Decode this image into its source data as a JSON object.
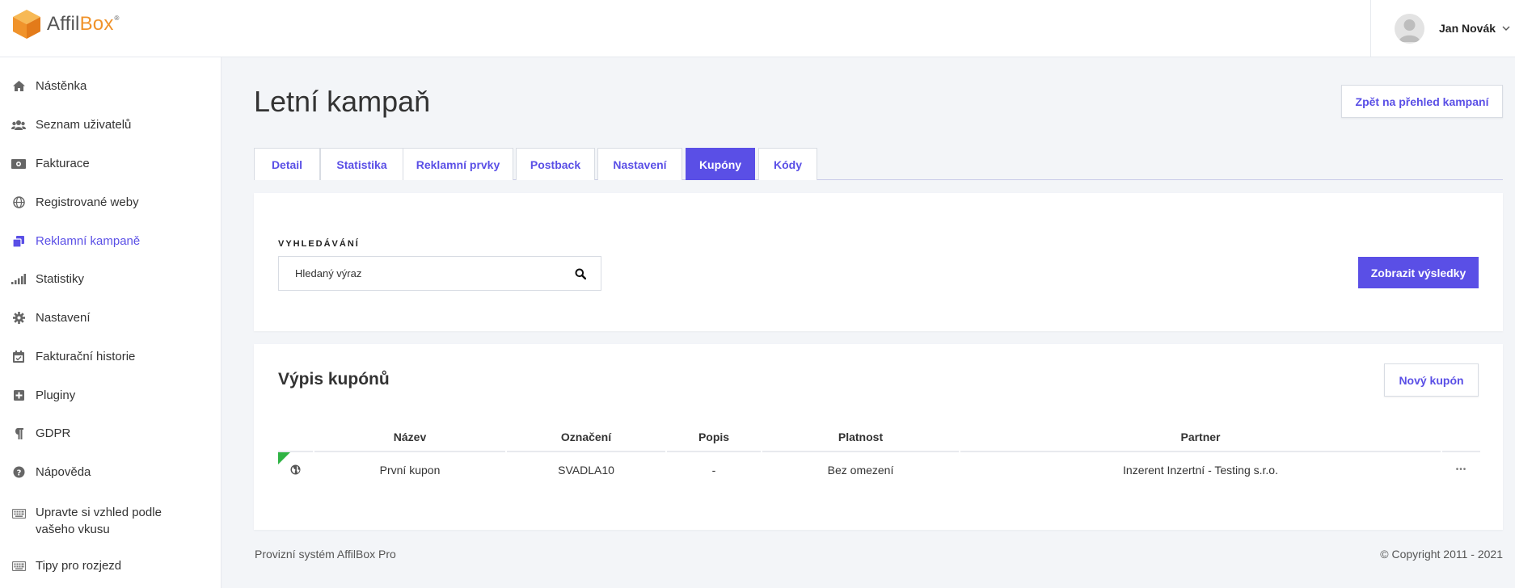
{
  "brand": {
    "part1": "Affil",
    "part2": "Box",
    "reg": "®",
    "accent_color": "#f0932b"
  },
  "user": {
    "name": "Jan Novák",
    "avatar_icon": "user-avatar"
  },
  "sidebar": {
    "items": [
      {
        "label": "Nástěnka",
        "icon": "home-icon"
      },
      {
        "label": "Seznam uživatelů",
        "icon": "users-icon"
      },
      {
        "label": "Fakturace",
        "icon": "money-icon"
      },
      {
        "label": "Registrované weby",
        "icon": "globe-icon"
      },
      {
        "label": "Reklamní kampaně",
        "icon": "copy-icon",
        "active": true
      },
      {
        "label": "Statistiky",
        "icon": "signal-icon"
      },
      {
        "label": "Nastavení",
        "icon": "gear-icon"
      },
      {
        "label": "Fakturační historie",
        "icon": "calendar-icon"
      },
      {
        "label": "Pluginy",
        "icon": "plus-square-icon"
      },
      {
        "label": "GDPR",
        "icon": "paragraph-icon"
      },
      {
        "label": "Nápověda",
        "icon": "question-icon"
      },
      {
        "label_line1": "Upravte si vzhled podle",
        "label_line2": "vašeho vkusu",
        "icon": "keyboard-icon"
      },
      {
        "label": "Tipy pro rozjezd",
        "icon": "keyboard-icon"
      }
    ]
  },
  "page": {
    "title": "Letní kampaň",
    "back_button": "Zpět na přehled kampaní",
    "accent_color": "#5a4fe6"
  },
  "tabs": [
    {
      "label": "Detail"
    },
    {
      "label": "Statistika"
    },
    {
      "label": "Reklamní prvky"
    },
    {
      "label": "Postback"
    },
    {
      "label": "Nastavení"
    },
    {
      "label": "Kupóny",
      "active": true
    },
    {
      "label": "Kódy"
    }
  ],
  "search": {
    "label": "VYHLEDÁVÁNÍ",
    "placeholder": "Hledaný výraz",
    "value": "",
    "submit_label": "Zobrazit výsledky"
  },
  "coupons": {
    "title": "Výpis kupónů",
    "new_button": "Nový kupón",
    "columns": [
      "Název",
      "Označení",
      "Popis",
      "Platnost",
      "Partner"
    ],
    "rows": [
      {
        "name": "První kupon",
        "code": "SVADLA10",
        "description": "-",
        "validity": "Bez omezení",
        "partner": "Inzerent Inzertní - Testing s.r.o.",
        "status_color": "#2fb344",
        "icon": "globe-icon",
        "more": "•••"
      }
    ]
  },
  "footer": {
    "left": "Provizní systém AffilBox Pro",
    "right": "© Copyright 2011 - 2021"
  }
}
